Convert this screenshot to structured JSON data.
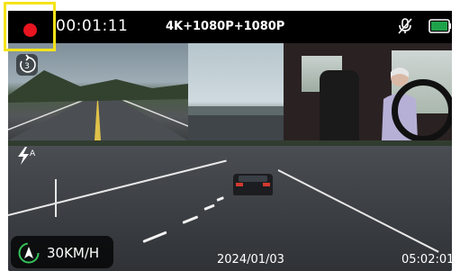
{
  "status_bar": {
    "recording_time": "00:01:11",
    "resolution": "4K+1080P+1080P"
  },
  "overlay": {
    "speed": "30KM/H",
    "date": "2024/01/03",
    "time": "05:02:01",
    "loop_number": "3",
    "flash_mode": "A"
  },
  "colors": {
    "record": "#e8141f",
    "highlight": "#f5e31a",
    "battery": "#1fa34a"
  },
  "icons": [
    "record-dot-icon",
    "mic-muted-icon",
    "battery-icon",
    "loop-recording-icon",
    "flash-auto-icon",
    "gps-compass-icon"
  ]
}
